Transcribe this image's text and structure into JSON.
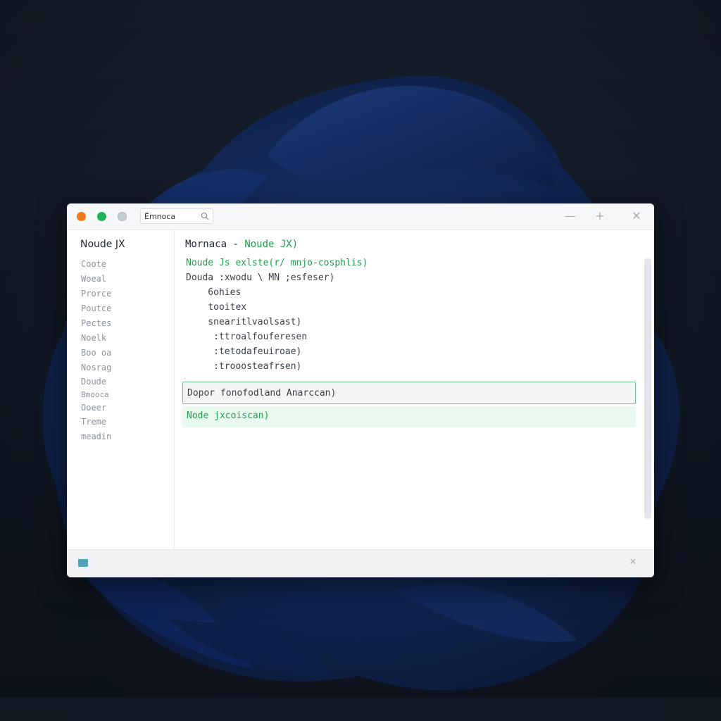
{
  "titlebar": {
    "search_value": "Ëmnoca",
    "minimize_glyph": "—",
    "maximize_glyph": "+",
    "close_glyph": "✕"
  },
  "sidebar": {
    "title": "Noude JX",
    "items": [
      "Coote",
      "Woeal",
      "Prorce",
      "Poutce",
      "Pectes",
      "Noelk",
      "Boo oa",
      "Nosrag",
      "Doude",
      "Bmooca",
      "Ooeer",
      "Treme",
      "meadin"
    ]
  },
  "editor": {
    "title_prefix": "Mornaca - ",
    "title_accent": "Noude JX)",
    "lines": [
      {
        "text": "Noude Js exlste(r/ mnjo-cosphlis)",
        "style": "green"
      },
      {
        "text": "Douda :xwodu \\ MN ;esfeser)",
        "style": "normal"
      },
      {
        "text": "    6ohies",
        "style": "normal"
      },
      {
        "text": "    tooitex",
        "style": "normal"
      },
      {
        "text": "    snearitlvaolsast)",
        "style": "normal"
      },
      {
        "text": "     :ttroalfouferesen",
        "style": "normal"
      },
      {
        "text": "     :tetodafeuiroae)",
        "style": "normal"
      },
      {
        "text": "     :trooosteafrsen)",
        "style": "normal"
      }
    ],
    "input_value": "Dopor fonofodland Anarccan)",
    "suggestion": "Node jxcoiscan)"
  },
  "statusbar": {
    "close_glyph": "✕"
  },
  "colors": {
    "accent_green": "#1f9d49",
    "traffic_orange": "#f07a1b",
    "traffic_green": "#20b257",
    "status_square": "#4ea3b8"
  }
}
